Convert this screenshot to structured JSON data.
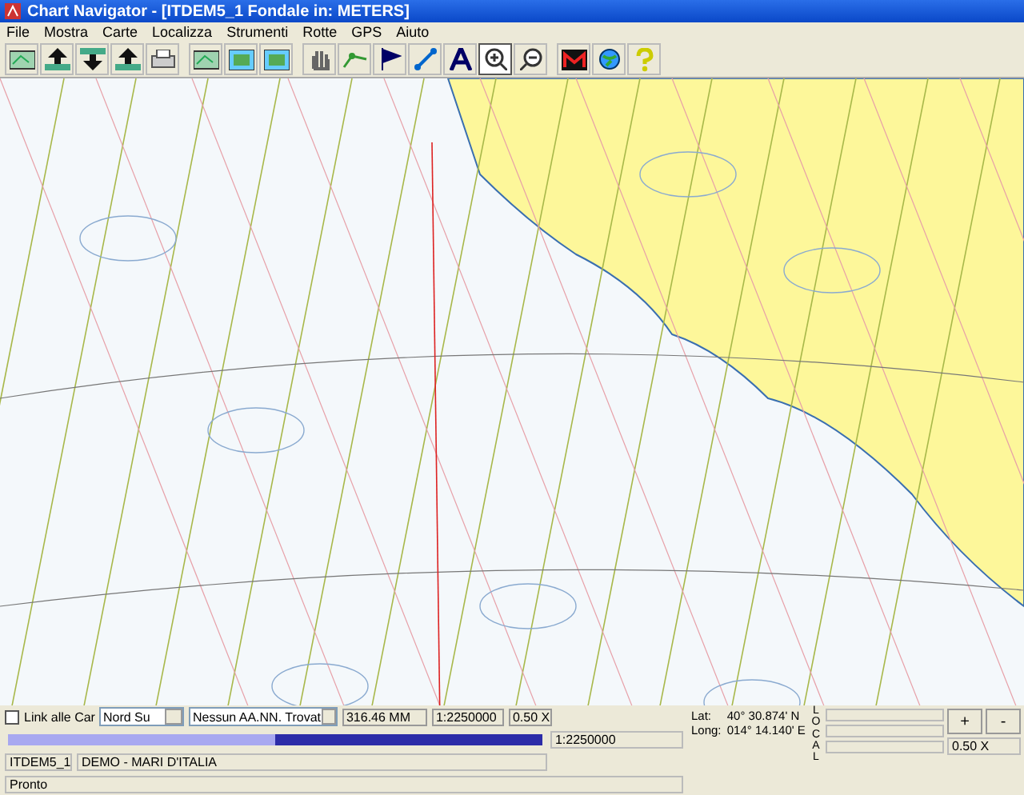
{
  "window": {
    "title": "Chart Navigator - [ITDEM5_1 Fondale in: METERS]"
  },
  "menu": [
    "File",
    "Mostra",
    "Carte",
    "Localizza",
    "Strumenti",
    "Rotte",
    "GPS",
    "Aiuto"
  ],
  "toolbar": [
    {
      "kind": "map",
      "selected": false
    },
    {
      "kind": "up",
      "selected": false
    },
    {
      "kind": "down",
      "selected": false
    },
    {
      "kind": "up",
      "selected": false
    },
    {
      "kind": "print",
      "selected": false
    },
    {
      "kind": "map",
      "selected": false
    },
    {
      "kind": "frame",
      "selected": false
    },
    {
      "kind": "frame",
      "selected": false
    },
    {
      "kind": "hand",
      "selected": false
    },
    {
      "kind": "route",
      "selected": false
    },
    {
      "kind": "flag",
      "selected": false
    },
    {
      "kind": "line",
      "selected": false
    },
    {
      "kind": "letter",
      "selected": false
    },
    {
      "kind": "zoomin",
      "selected": true
    },
    {
      "kind": "zoomout",
      "selected": false
    },
    {
      "kind": "logo",
      "selected": false
    },
    {
      "kind": "globe",
      "selected": false
    },
    {
      "kind": "help",
      "selected": false
    }
  ],
  "controls": {
    "link": {
      "label": "Link  alle Car",
      "checked": false
    },
    "orientation": "Nord Su",
    "aids": "Nessun AA.NN. Trovat",
    "distance": "316.46 MM",
    "scale": "1:2250000",
    "zoom": "0.50 X"
  },
  "progress": {
    "level": 0.5,
    "scale": "1:2250000"
  },
  "position": {
    "lat_label": "Lat:",
    "lat": "40° 30.874' N",
    "long_label": "Long:",
    "long": "014° 14.140' E",
    "mode": "LOCAL"
  },
  "right_panel": {
    "buttons": [
      "+",
      "-"
    ],
    "zoom": "0.50 X"
  },
  "status": {
    "chart": "ITDEM5_1",
    "name": "DEMO - MARI D'ITALIA",
    "message": "Pronto"
  }
}
